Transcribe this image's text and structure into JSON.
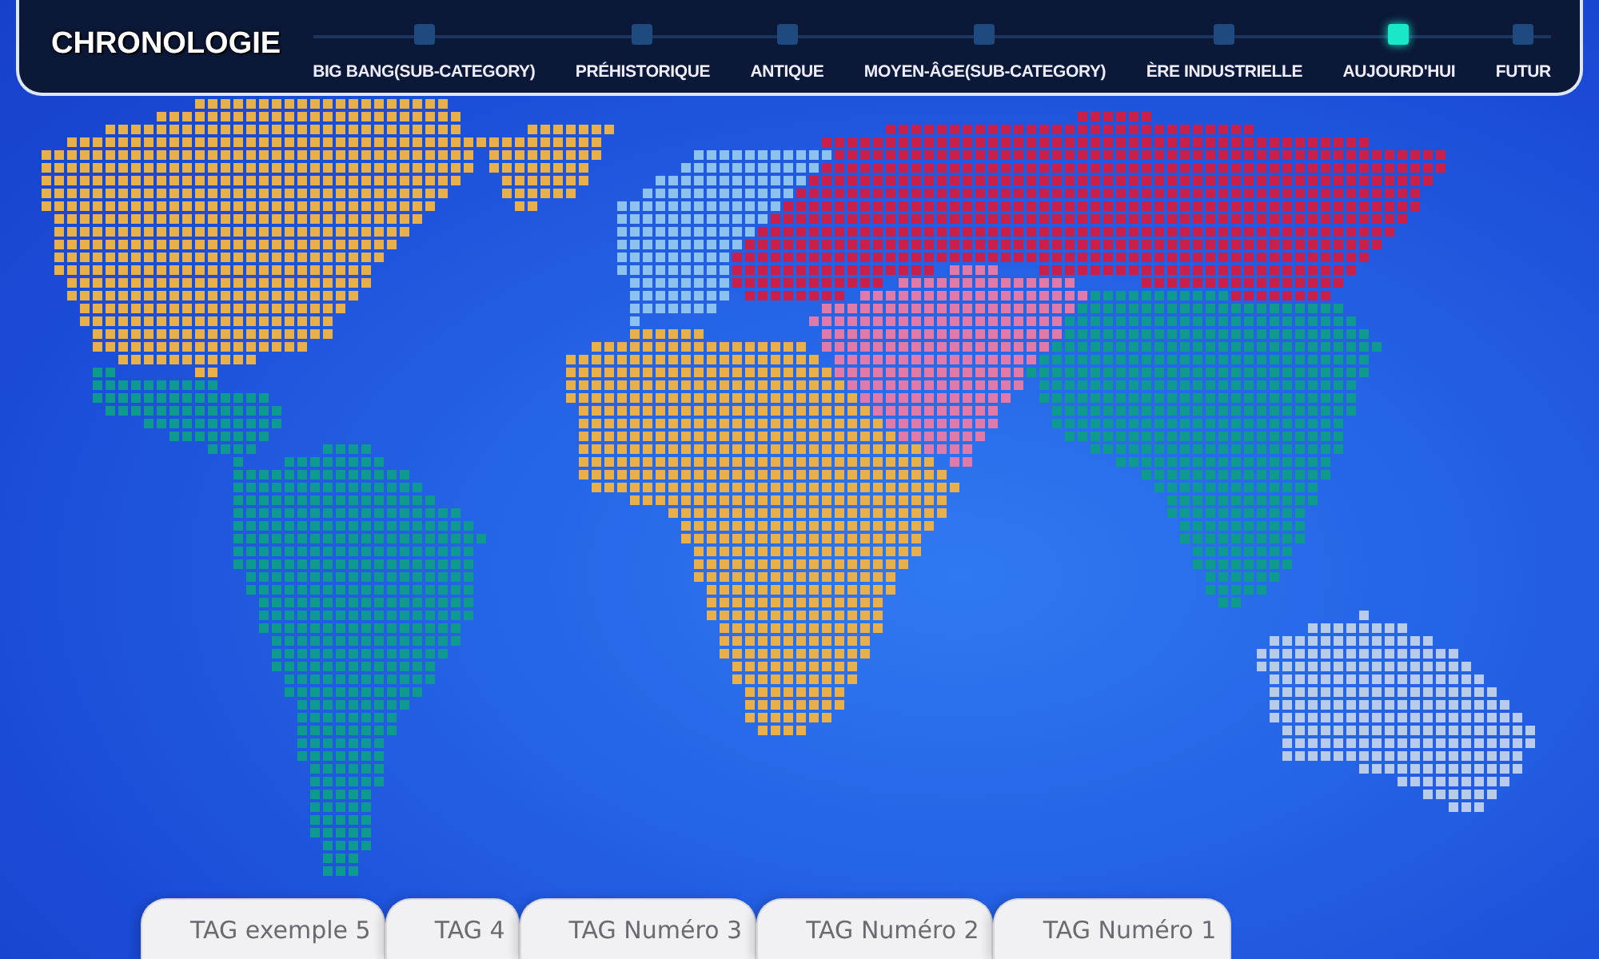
{
  "header": {
    "title": "CHRONOLOGIE"
  },
  "timeline": [
    {
      "label": "BIG BANG(SUB-CATEGORY)",
      "selected": false
    },
    {
      "label": "PRÉHISTORIQUE",
      "selected": false
    },
    {
      "label": "ANTIQUE",
      "selected": false
    },
    {
      "label": "MOYEN-ÂGE(SUB-CATEGORY)",
      "selected": false
    },
    {
      "label": "ÈRE INDUSTRIELLE",
      "selected": false
    },
    {
      "label": "AUJOURD'HUI",
      "selected": true
    },
    {
      "label": "FUTUR",
      "selected": false
    }
  ],
  "tags": [
    "TAG exemple 5",
    "TAG 4",
    "TAG Numéro 3",
    "TAG Numéro 2",
    "TAG Numéro 1"
  ]
}
